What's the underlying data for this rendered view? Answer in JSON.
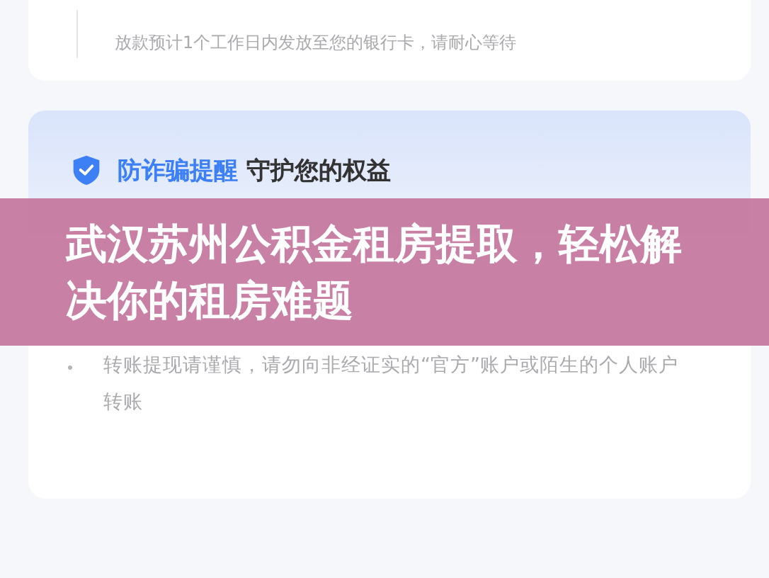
{
  "payout_card": {
    "note": "放款预计1个工作日内发放至您的银行卡，请耐心等待"
  },
  "fraud_card": {
    "title_highlight": "防诈骗提醒",
    "title_rest": "守护您的权益",
    "tips": [
      "转账提现请谨慎，请勿向非经证实的“官方”账户或陌生的个人账户转账"
    ]
  },
  "banner": {
    "title": "武汉苏州公积金租房提取，轻松解决你的租房难题"
  }
}
